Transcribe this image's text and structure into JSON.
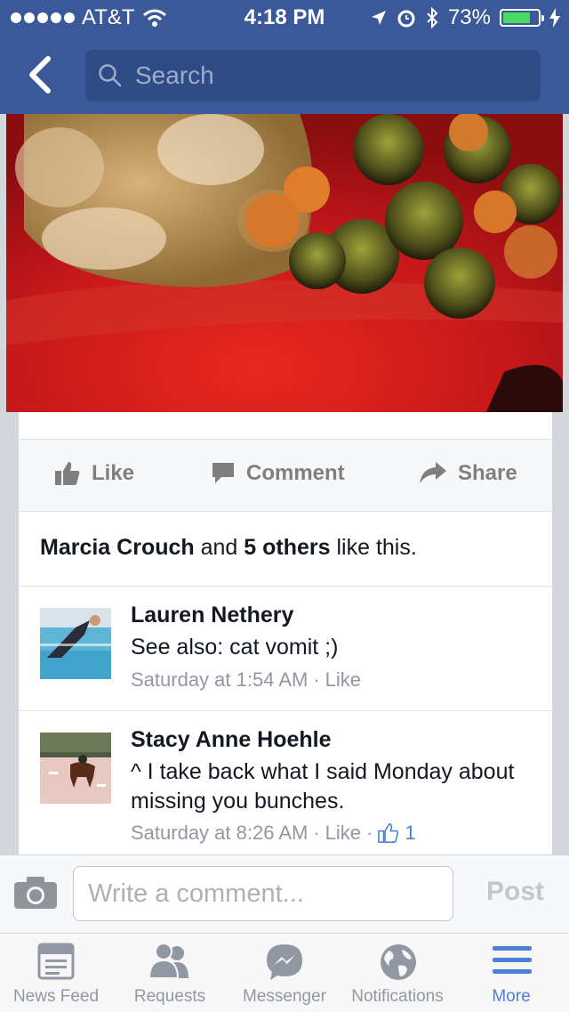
{
  "status_bar": {
    "carrier": "AT&T",
    "time": "4:18 PM",
    "battery": "73%",
    "battery_level": 0.73
  },
  "nav": {
    "search_placeholder": "Search"
  },
  "post_actions": {
    "like": "Like",
    "comment": "Comment",
    "share": "Share"
  },
  "likes_summary": {
    "first_name": "Marcia Crouch",
    "and": " and ",
    "others": "5 others",
    "suffix": " like this."
  },
  "comments": [
    {
      "name": "Lauren Nethery",
      "text": "See also: cat vomit ;)",
      "time": "Saturday at 1:54 AM",
      "like_label": "Like"
    },
    {
      "name": "Stacy Anne Hoehle",
      "text": "^ I take back what I said Monday about missing you bunches.",
      "time": "Saturday at 8:26 AM",
      "like_label": "Like",
      "like_count": "1"
    }
  ],
  "composer": {
    "placeholder": "Write a comment...",
    "post_label": "Post"
  },
  "tabs": [
    {
      "label": "News Feed",
      "icon": "news-feed-icon"
    },
    {
      "label": "Requests",
      "icon": "friend-requests-icon"
    },
    {
      "label": "Messenger",
      "icon": "messenger-icon"
    },
    {
      "label": "Notifications",
      "icon": "globe-icon"
    },
    {
      "label": "More",
      "icon": "hamburger-menu-icon",
      "active": true
    }
  ],
  "colors": {
    "brand_blue": "#3b5998",
    "active_tab": "#4a80d8",
    "battery_green": "#4cd964"
  }
}
